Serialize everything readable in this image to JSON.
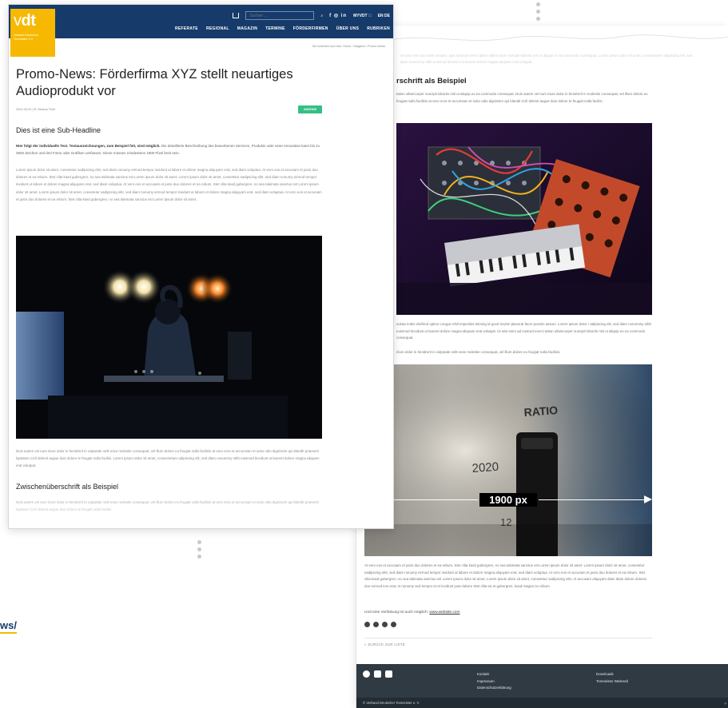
{
  "dimension_label": "1900 px",
  "url_fragment": "ws/",
  "front": {
    "logo": {
      "light": "v",
      "bold": "dt",
      "subtitle": "Verband Deutscher Tonmeister e.V."
    },
    "search_placeholder": "Suchen ...",
    "social_label": "f ◎ in",
    "myvdt_label": "MYVDT ⃝",
    "language_label": "EN DE",
    "menu": [
      "REFERATE",
      "REGIONAL",
      "MAGAZIN",
      "TERMINE",
      "FÖRDERFIRMEN",
      "ÜBER UNS",
      "RUBRIKEN"
    ],
    "breadcrumb": "Sie befinden sich hier:  Home  /  Magazin  /  Promo-News",
    "title": "Promo-News: Förderfirma XYZ stellt neuartiges Audioprodukt vor",
    "meta": "2024-03-01 | R. Markus Thiel",
    "badge": "ANZEIGE",
    "subheadline": "Dies ist eine Sub-Headline",
    "lead_bold": "Hier folgt der individuelle Text. Textauszeichnungen, zum Beispiel fett, sind möglich.",
    "lead_rest": " Die detaillierte Beschreibung des beworbenen Services, Produkts oder einer Innovation kann bis zu 3600 Zeichen und drei Fotos oder Grafiken umfassen. Diese müssen mindestens 1900 Pixel breit sein.",
    "body1": "Lorem ipsum dolor sit amet, consetetur sadipscing elitr, sed diam nonumy eirmod tempor invidunt ut labore et dolore magna aliquyam erat, sed diam voluptua. At vero eos et accusam et justo duo dolores et ea rebum. Stet clita kasd gubergren, no sea takimata sanctus est Lorem ipsum dolor sit amet. Lorem ipsum dolor sit amet, consetetur sadipscing elitr, sed diam nonumy eirmod tempor invidunt ut labore et dolore magna aliquyam erat, sed diam voluptua. At vero eos et accusam et justo duo dolores et ea rebum. Stet clita kasd gubergren, no sea takimata sanctus est Lorem ipsum dolor sit amet. Lorem ipsum dolor sit amet, consetetur sadipscing elitr, sed diam nonumy eirmod tempor invidunt ut labore et dolore magna aliquyam erat, sed diam voluptua. At vero eos et accusam et justo duo dolores et ea rebum. Stet clita kasd gubergren, no sea takimata sanctus est Lorem ipsum dolor sit amet.",
    "body2": "Duis autem vel eum iriure dolor in hendrerit in vulputate velit esse molestie consequat, vel illum dolore eu feugiat nulla facilisis at vero eros et accumsan et iusto odio dignissim qui blandit praesent luptatum zzril delenit augue duis dolore te feugait nulla facilisi. Lorem ipsum dolor sit amet, consectetuer adipiscing elit, sed diam nonummy nibh euismod tincidunt ut laoreet dolore magna aliquam erat volutpat.",
    "subheadline2": "Zwischenüberschrift als Beispiel",
    "body3": "Duis autem vel eum iriure dolor in hendrerit in vulputate velit esse molestie consequat, vel illum dolore eu feugiat nulla facilisis at vero eros et accumsan et iusto odio dignissim qui blandit praesent luptatum zzril delenit augue duis dolore te feugait nulla facilisi."
  },
  "back": {
    "faded_top": "Ut wisi enim ad minim veniam, quis nostrud exerci tation ullamcorper suscipit lobortis nisl ut aliquip ex ea commodo consequat. Lorem ipsum dolor sit amet, consectetuer adipiscing elit, sed diam nonummy nibh euismod tincidunt ut laoreet dolore magna aliquam erat volutpat.",
    "heading": "rschrift als Beispiel",
    "para1": "tation ullamcorper suscipit lobortis nisl ut aliquip ex ea commodo consequat. Duis autem vel eum iriure dolor in hendrerit in molestie consequat, vel illum dolore eu feugiat nulla facilisis at vero eros et accumsan et iusto odio dignissim qui blandit zzril delenit augue duis dolore te feugait nulla facilisi.",
    "para2": "soluta nobis eleifend option congue nihil imperdiet doming id quod mazim placerat facer possim assum. Lorem ipsum dolor r adipiscing elit, sed diam nonummy nibh euismod tincidunt ut laoreet dolore magna aliquam erat volutpat. Ut wisi enim ad nostrud exerci tation ullamcorper suscipit lobortis nisl ut aliquip ex ea commodo consequat.",
    "para3": "iriure dolor in hendrerit in vulputate velit esse molestie consequat, vel illum dolore eu feugiat nulla facilisis.",
    "image_text_ratio": "RATIO",
    "image_text_year": "2020",
    "image_text_twelve": "12",
    "closing": "At vero eos et accusam et justo duo dolores et ea rebum. Stet clita kasd gubergren, no sea takimata sanctus est Lorem ipsum dolor sit amet. Lorem ipsum dolor sit amet, consetetur sadipscing elitr, sed diam nonumy eirmod tempor invidunt ut labore et dolore magna aliquyam erat, sed diam voluptua. At vero eos et accusam et justo duo dolores et ea rebum. Stet clita kasd gubergren, no sea takimata sanctus est Lorem ipsum dolor sit amet. Lorem ipsum dolor sit amet, consetetur sadipscing elitr, At accusam aliquyam diam diam dolore dolores duo eirmod eos erat, et nonumy sed tempor et et invidunt justo labore Stet clita ea et gubergren, kasd magna no rebum.",
    "link_prefix": "Und eine Verlinkung ist auch möglich: ",
    "link_text": "www.website.com",
    "back_link": "«  ZURÜCK ZUR LISTE",
    "footer": {
      "col1": [
        "Kontakt",
        "Impressum",
        "Datenschutzerklärung"
      ],
      "col2": [
        "Downloads",
        "Tonmeister Weiterall"
      ],
      "copyright": "© Verband Deutscher Tonmeister e. V."
    }
  }
}
